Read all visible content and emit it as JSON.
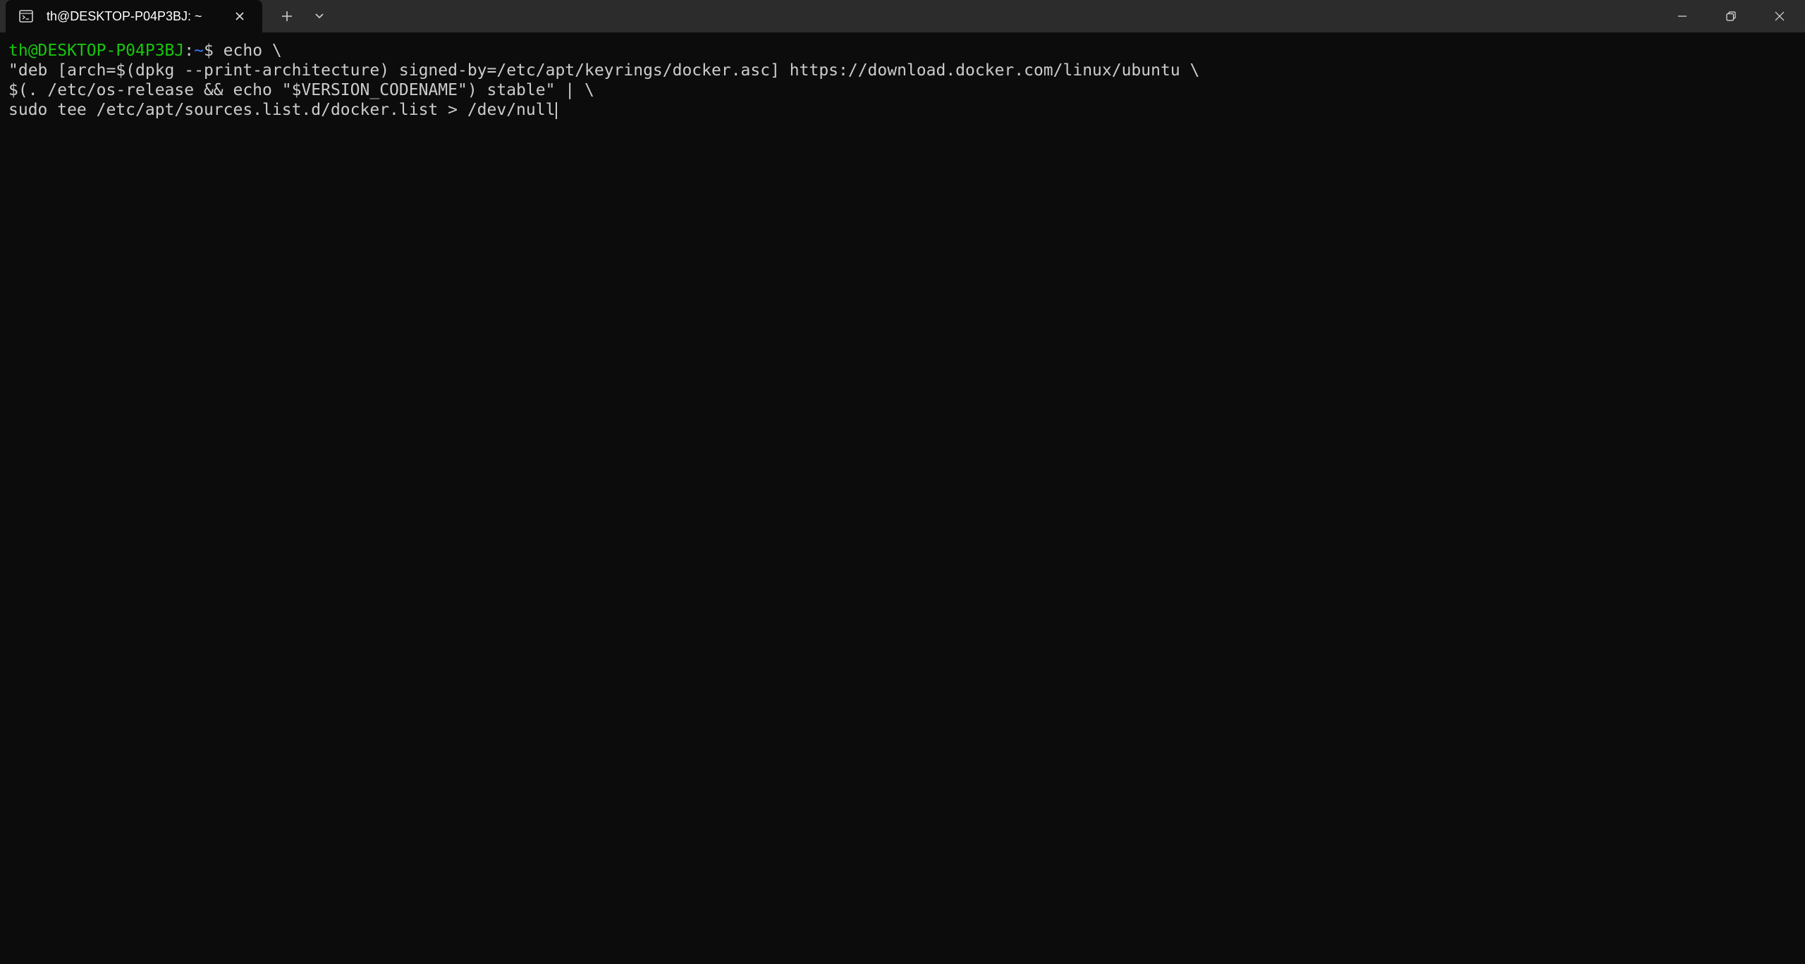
{
  "window": {
    "tab_title": "th@DESKTOP-P04P3BJ: ~",
    "icons": {
      "tab": "terminal-icon",
      "close_tab": "close-icon",
      "new_tab": "plus-icon",
      "dropdown": "chevron-down-icon",
      "minimize": "minimize-icon",
      "restore": "restore-icon",
      "close_window": "close-icon"
    }
  },
  "terminal": {
    "prompt_user": "th@DESKTOP-P04P3BJ",
    "prompt_colon": ":",
    "prompt_path": "~",
    "prompt_symbol": "$ ",
    "command_first_line": "echo \\",
    "lines": [
      "\"deb [arch=$(dpkg --print-architecture) signed-by=/etc/apt/keyrings/docker.asc] https://download.docker.com/linux/ubuntu \\",
      "$(. /etc/os-release && echo \"$VERSION_CODENAME\") stable\" | \\",
      "sudo tee /etc/apt/sources.list.d/docker.list > /dev/null"
    ]
  },
  "colors": {
    "background": "#0c0c0c",
    "titlebar": "#2c2c2c",
    "prompt_user": "#16c60c",
    "prompt_path": "#3b78ff",
    "text": "#cccccc"
  }
}
